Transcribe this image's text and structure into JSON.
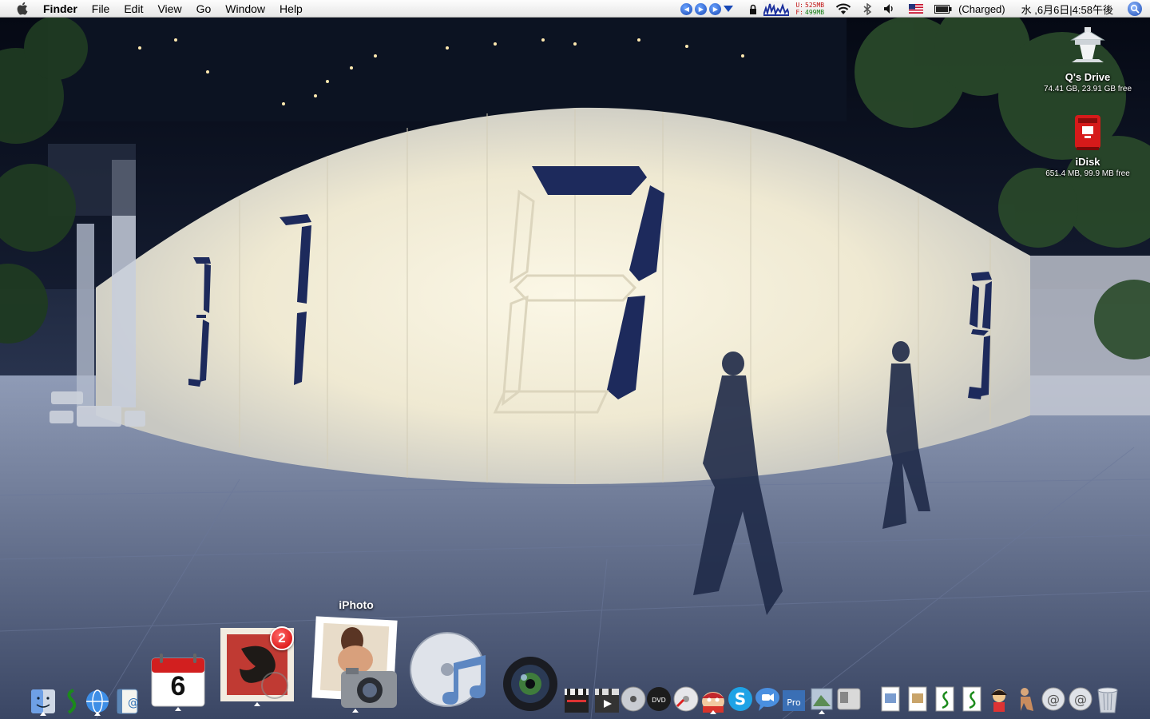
{
  "menubar": {
    "app_name": "Finder",
    "menus": [
      "File",
      "Edit",
      "View",
      "Go",
      "Window",
      "Help"
    ],
    "memory": {
      "used_label": "U:",
      "used": "525MB",
      "free_label": "F:",
      "free": "499MB"
    },
    "battery_status": "(Charged)",
    "clock": "水 ,6月6日|4:58午後",
    "icons": [
      "apple-icon",
      "itunes-prev-icon",
      "itunes-play-icon",
      "itunes-next-icon",
      "menu-triangle-icon",
      "lock-icon",
      "cpu-graph-icon",
      "wifi-icon",
      "bluetooth-icon",
      "volume-icon",
      "us-flag-icon",
      "battery-icon",
      "spotlight-icon"
    ]
  },
  "desktop": {
    "icons": [
      {
        "name": "Q's Drive",
        "info": "74.41 GB, 23.91 GB free",
        "icon": "hard-drive-icon"
      },
      {
        "name": "iDisk",
        "info": "651.4 MB, 99.9 MB free",
        "icon": "idisk-mailbox-icon"
      }
    ]
  },
  "wallpaper": {
    "digits": [
      "3",
      "7",
      "7",
      "9"
    ],
    "description_colors": {
      "wall": "#f4efdb",
      "segment": "#1d2a5c",
      "night": "#0b1120"
    }
  },
  "dock": {
    "hover_label": "iPhoto",
    "calendar_day": "6",
    "mail_badge": "2",
    "items": [
      "finder",
      "script-editor",
      "network",
      "address-book",
      "ical",
      "mail",
      "iphoto",
      "itunes",
      "photo-booth",
      "final-cut",
      "imovie",
      "dvd-player",
      "dvd-studio",
      "cd-burn",
      "south-park",
      "skype",
      "ichat",
      "aperture",
      "preview",
      "boot-camp",
      "pdf-doc-1",
      "pdf-doc-2",
      "script-doc-1",
      "script-doc-2",
      "doll",
      "figure",
      "mail-app-1",
      "mail-app-2",
      "trash"
    ]
  }
}
